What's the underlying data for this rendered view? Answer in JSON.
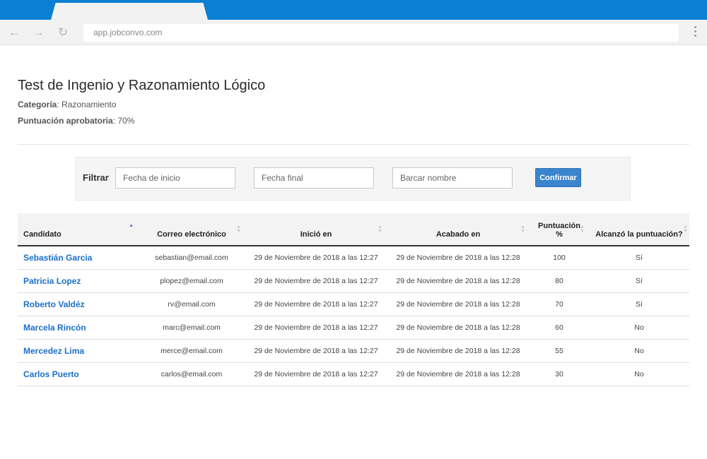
{
  "browser": {
    "url": "app.jobconvo.com",
    "back_icon": "arrow-left-icon",
    "forward_icon": "arrow-right-icon",
    "reload_icon": "reload-icon",
    "menu_icon": "kebab-menu-icon"
  },
  "page": {
    "title": "Test de Ingenio y Razonamiento Lógico",
    "category_label": "Categoría",
    "category_value": ": Razonamiento",
    "pass_label": "Puntuación aprobatoria",
    "pass_value": ": 70%"
  },
  "filter": {
    "label": "Filtrar",
    "start_placeholder": "Fecha de inicio",
    "end_placeholder": "Fecha final",
    "name_placeholder": "Barcar nombre",
    "confirm_label": "Confirmar"
  },
  "table": {
    "headers": {
      "candidate": "Candidato",
      "email": "Correo electrónico",
      "started": "Inició en",
      "finished": "Acabado en",
      "score": "Puntuación %",
      "reached": "Alcanzó la puntuación?"
    },
    "rows": [
      {
        "name": "Sebastián Garcia",
        "email": "sebastian@email.com",
        "started": "29 de Noviembre de 2018 a las 12:27",
        "finished": "29 de Noviembre de 2018 a las 12:28",
        "score": "100",
        "reached": "Sí"
      },
      {
        "name": "Patricia Lopez",
        "email": "plopez@email.com",
        "started": "29 de Noviembre de 2018 a las 12:27",
        "finished": "29 de Noviembre de 2018 a las 12:28",
        "score": "80",
        "reached": "Sí"
      },
      {
        "name": "Roberto Valdéz",
        "email": "rv@email.com",
        "started": "29 de Noviembre de 2018 a las 12:27",
        "finished": "29 de Noviembre de 2018 a las 12:28",
        "score": "70",
        "reached": "Sí"
      },
      {
        "name": "Marcela Rincón",
        "email": "marc@email.com",
        "started": "29 de Noviembre de 2018 a las 12:27",
        "finished": "29 de Noviembre de 2018 a las 12:28",
        "score": "60",
        "reached": "No"
      },
      {
        "name": "Mercedez Lima",
        "email": "merce@email.com",
        "started": "29 de Noviembre de 2018 a las 12:27",
        "finished": "29 de Noviembre de 2018 a las 12:28",
        "score": "55",
        "reached": "No"
      },
      {
        "name": "Carlos Puerto",
        "email": "carlos@email.com",
        "started": "29 de Noviembre de 2018 a las 12:27",
        "finished": "29 de Noviembre de 2018 a las 12:28",
        "score": "30",
        "reached": "No"
      }
    ]
  },
  "colors": {
    "chrome_blue": "#0b7fd1",
    "link_blue": "#1a6fc9",
    "button_blue": "#3a85cd"
  }
}
